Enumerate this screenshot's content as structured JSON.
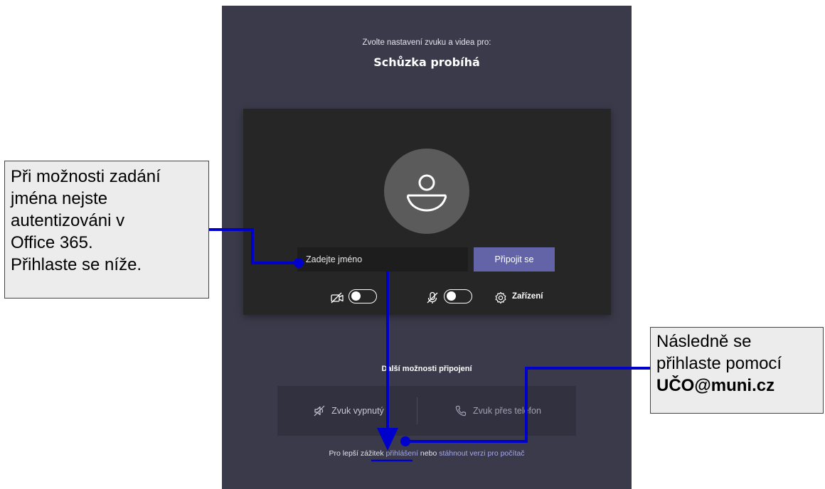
{
  "meeting": {
    "subtitle": "Zvolte nastavení zvuku a videa pro:",
    "title": "Schůzka probíhá"
  },
  "join": {
    "name_placeholder": "Zadejte jméno",
    "join_button": "Připojit se"
  },
  "devices": {
    "camera_icon": "camera-off-icon",
    "mic_icon": "mic-off-icon",
    "settings_icon": "gear-icon",
    "settings_label": "Zařízení"
  },
  "more": {
    "title": "Další možnosti připojení",
    "audio_off": "Zvuk vypnutý",
    "phone_audio": "Zvuk přes telefon"
  },
  "footer": {
    "prefix": "Pro lepší zážitek ",
    "signin_link": "přihlášení",
    "middle": " nebo ",
    "download_link": "stáhnout verzi pro počítač"
  },
  "annotations": {
    "left_lines": [
      "Při možnosti zadání",
      "jména nejste",
      "autentizováni v",
      "Office 365.",
      "Přihlaste se níže."
    ],
    "right_lines": [
      "Následně se",
      "přihlaste pomocí",
      "UČO@muni.cz"
    ],
    "arrow_color": "#0000cc"
  }
}
